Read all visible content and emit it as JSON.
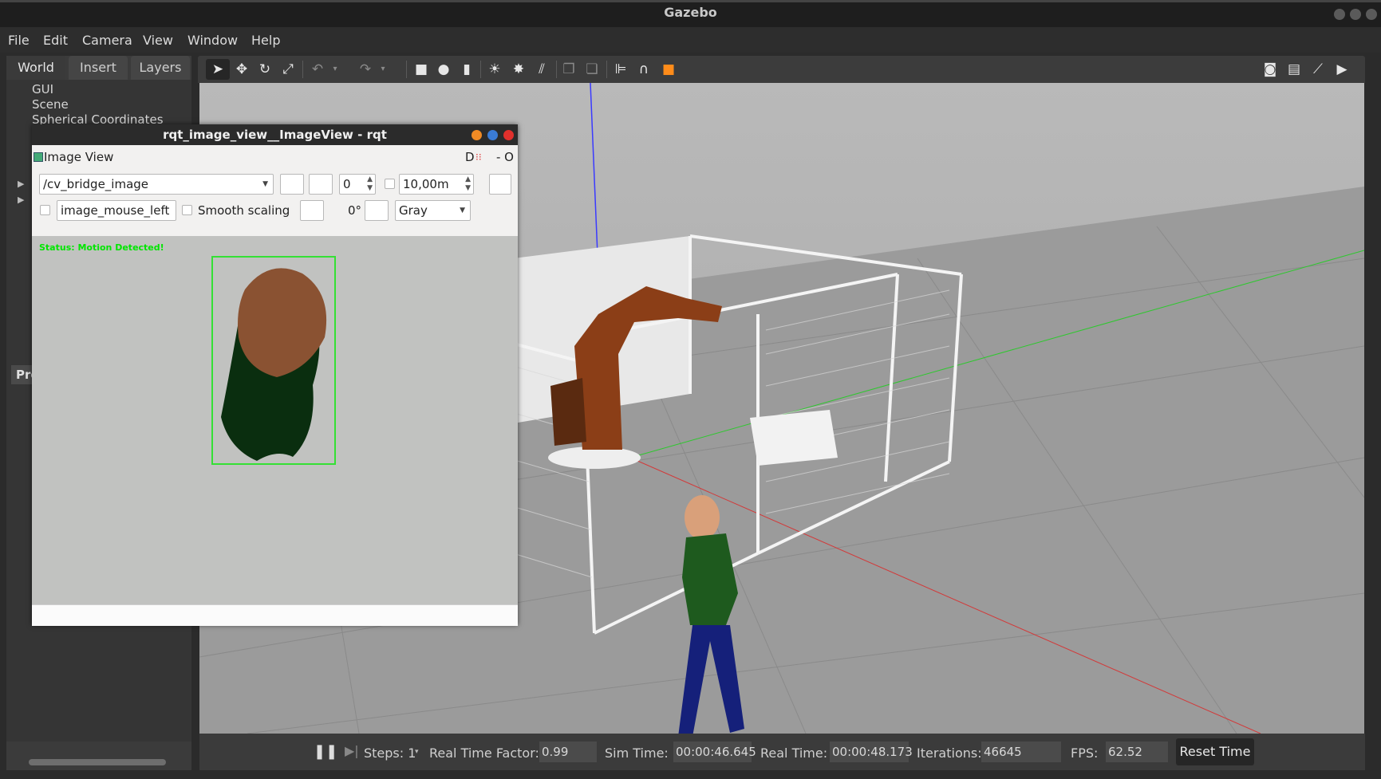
{
  "window": {
    "title": "Gazebo"
  },
  "menu": [
    "File",
    "Edit",
    "Camera",
    "View",
    "Window",
    "Help"
  ],
  "left_panel": {
    "tabs": [
      "World",
      "Insert",
      "Layers"
    ],
    "tree": [
      "GUI",
      "Scene",
      "Spherical Coordinates"
    ],
    "props_label": "Pro"
  },
  "toolbar_icons": [
    "select-arrow",
    "translate",
    "rotate",
    "scale",
    "undo",
    "redo",
    "box",
    "sphere",
    "cylinder",
    "point-light",
    "spot-light",
    "directional-light",
    "copy",
    "paste",
    "align",
    "snap",
    "view-angle",
    "screenshot",
    "log",
    "plot",
    "video"
  ],
  "rqt": {
    "title": "rqt_image_view__ImageView - rqt",
    "plugin_label": "Image View",
    "header_right_d": "D",
    "header_right_o": "- O",
    "topic": "/cv_bridge_image",
    "spin_value": "0",
    "distance": "10,00m",
    "mouse_topic": "image_mouse_left",
    "smooth_scaling": "Smooth scaling",
    "rotation": "0°",
    "color_mode": "Gray",
    "image_status": "Status: Motion Detected!"
  },
  "status": {
    "steps_label": "Steps: 1",
    "rtf_label": "Real Time Factor:",
    "rtf_value": "0.99",
    "sim_label": "Sim Time:",
    "sim_value": "00:00:46.645",
    "real_label": "Real Time:",
    "real_value": "00:00:48.173",
    "iter_label": "Iterations:",
    "iter_value": "46645",
    "fps_label": "FPS:",
    "fps_value": "62.52",
    "reset_label": "Reset Time"
  }
}
